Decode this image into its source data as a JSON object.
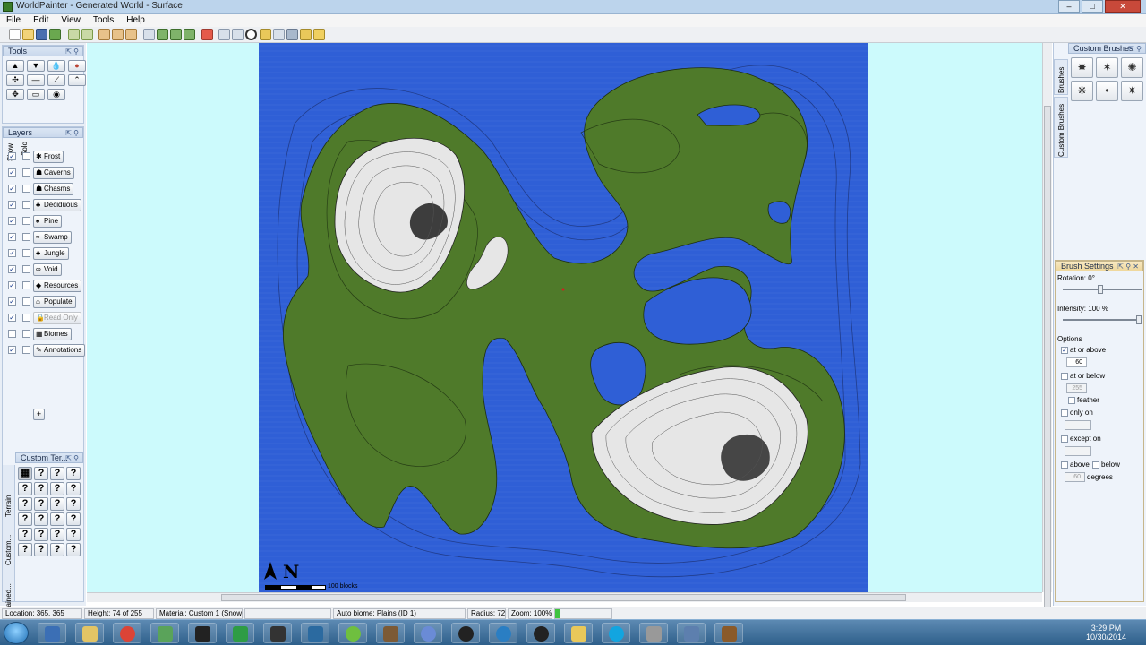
{
  "window": {
    "title": "WorldPainter - Generated World - Surface"
  },
  "menu": {
    "items": [
      "File",
      "Edit",
      "View",
      "Tools",
      "Help"
    ]
  },
  "tools_panel": {
    "title": "Tools",
    "buttons": [
      "raise-icon",
      "lower-icon",
      "water-icon",
      "lava-icon",
      "smooth-icon",
      "flatten-icon",
      "slope-icon",
      "mountain-icon",
      "spray-icon",
      "text-icon",
      "globe-icon"
    ]
  },
  "layers_panel": {
    "title": "Layers",
    "col_show": "Show",
    "col_solo": "Solo",
    "layers": [
      {
        "name": "Frost",
        "show": true,
        "icon": "✱"
      },
      {
        "name": "Caverns",
        "show": true,
        "icon": "☗"
      },
      {
        "name": "Chasms",
        "show": true,
        "icon": "☗"
      },
      {
        "name": "Deciduous",
        "show": true,
        "icon": "♣"
      },
      {
        "name": "Pine",
        "show": true,
        "icon": "♠"
      },
      {
        "name": "Swamp",
        "show": true,
        "icon": "≈"
      },
      {
        "name": "Jungle",
        "show": true,
        "icon": "♣"
      },
      {
        "name": "Void",
        "show": true,
        "icon": "∞"
      },
      {
        "name": "Resources",
        "show": true,
        "icon": "◆"
      },
      {
        "name": "Populate",
        "show": true,
        "icon": "⌂"
      },
      {
        "name": "Read Only",
        "show": true,
        "icon": "🔒",
        "disabled": true
      },
      {
        "name": "Biomes",
        "show": false,
        "icon": "▦"
      },
      {
        "name": "Annotations",
        "show": true,
        "icon": "✎"
      }
    ],
    "add_label": "+"
  },
  "terrain_panel": {
    "title": "Custom Ter...",
    "tab_terrain": "Terrain",
    "tab_custom": "Custom...",
    "tab_stained": "Stained...",
    "unknown": "?"
  },
  "map": {
    "scale_label": "100 blocks",
    "north_label": "N"
  },
  "right_dock": {
    "custom_brushes_title": "Custom Brushes",
    "tab_brushes": "Brushes",
    "tab_custom_brushes": "Custom Brushes"
  },
  "brush_settings": {
    "title": "Brush Settings",
    "rotation": "Rotation: 0°",
    "intensity": "Intensity: 100 %",
    "options_label": "Options",
    "at_or_above": "at or above",
    "at_or_above_value": "60",
    "at_or_below": "at or below",
    "at_or_below_value": "255",
    "feather": "feather",
    "only_on": "only on",
    "except_on": "except on",
    "above": "above",
    "below": "below",
    "degrees_value": "60",
    "degrees": "degrees"
  },
  "status": {
    "location": "Location: 365, 365",
    "height": "Height: 74 of 255",
    "material": "Material: Custom 1 (Snow...",
    "empty": "",
    "biome": "Auto biome: Plains (ID 1)",
    "radius": "Radius: 72",
    "zoom": "Zoom: 100%"
  },
  "taskbar": {
    "time": "3:29 PM",
    "date": "10/30/2014"
  },
  "colors": {
    "water": "#2f5fd6",
    "grass": "#4f7a2a",
    "snow": "#e8e8e8",
    "background": "#ccfafc"
  }
}
